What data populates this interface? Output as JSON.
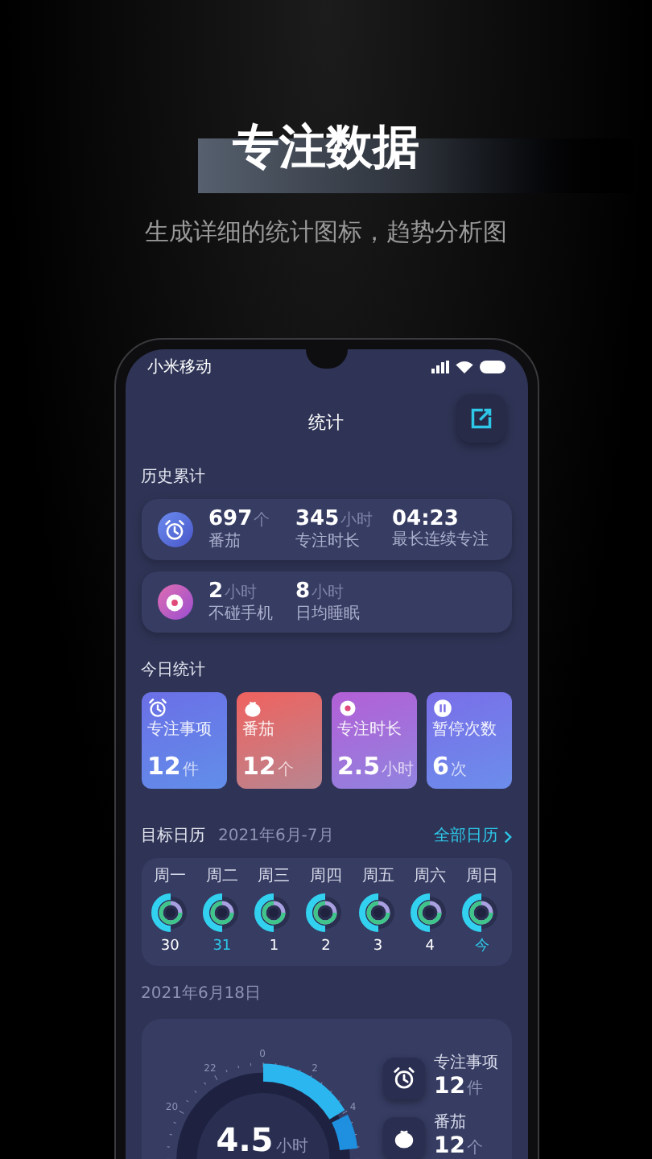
{
  "header": {
    "title": "专注数据",
    "subtitle": "生成详细的统计图标，趋势分析图"
  },
  "status_bar": {
    "carrier": "小米移动"
  },
  "nav": {
    "title": "统计"
  },
  "history": {
    "title": "历史累计",
    "cards": [
      {
        "kind": "alarm",
        "stats": [
          {
            "value": "697",
            "unit": "个",
            "label": "番茄"
          },
          {
            "value": "345",
            "unit": "小时",
            "label": "专注时长"
          },
          {
            "value": "04:23",
            "label": "最长连续专注"
          }
        ]
      },
      {
        "kind": "disc",
        "stats": [
          {
            "value": "2",
            "unit": "小时",
            "label": "不碰手机"
          },
          {
            "value": "8",
            "unit": "小时",
            "label": "日均睡眠"
          }
        ]
      }
    ]
  },
  "today": {
    "title": "今日统计",
    "tiles": [
      {
        "kind": "alarm",
        "color": "#6b6fe6",
        "label": "专注事项",
        "value": "12",
        "unit": "件"
      },
      {
        "kind": "tomato",
        "color": "#f0625e",
        "label": "番茄",
        "value": "12",
        "unit": "个"
      },
      {
        "kind": "disc",
        "color": "#b35fd6",
        "label": "专注时长",
        "value": "2.5",
        "unit": "小时"
      },
      {
        "kind": "pause",
        "color": "#7a6ee8",
        "label": "暂停次数",
        "value": "6",
        "unit": "次"
      }
    ]
  },
  "calendar": {
    "title": "目标日历",
    "range": "2021年6月-7月",
    "link": "全部日历",
    "days": [
      {
        "weekday": "周一",
        "date": "30",
        "highlighted": false
      },
      {
        "weekday": "周二",
        "date": "31",
        "highlighted": true
      },
      {
        "weekday": "周三",
        "date": "1",
        "highlighted": false
      },
      {
        "weekday": "周四",
        "date": "2",
        "highlighted": false
      },
      {
        "weekday": "周五",
        "date": "3",
        "highlighted": false
      },
      {
        "weekday": "周六",
        "date": "4",
        "highlighted": false
      },
      {
        "weekday": "周日",
        "date": "今",
        "highlighted": true
      }
    ]
  },
  "detail": {
    "date": "2021年6月18日",
    "dial_labels": [
      "0",
      "2",
      "4",
      "22",
      "20"
    ],
    "reading": "4.5",
    "unit": "小时",
    "items": [
      {
        "kind": "alarm",
        "label": "专注事项",
        "value": "12",
        "unit": "件"
      },
      {
        "kind": "tomato",
        "label": "番茄",
        "value": "12",
        "unit": "个"
      }
    ]
  }
}
